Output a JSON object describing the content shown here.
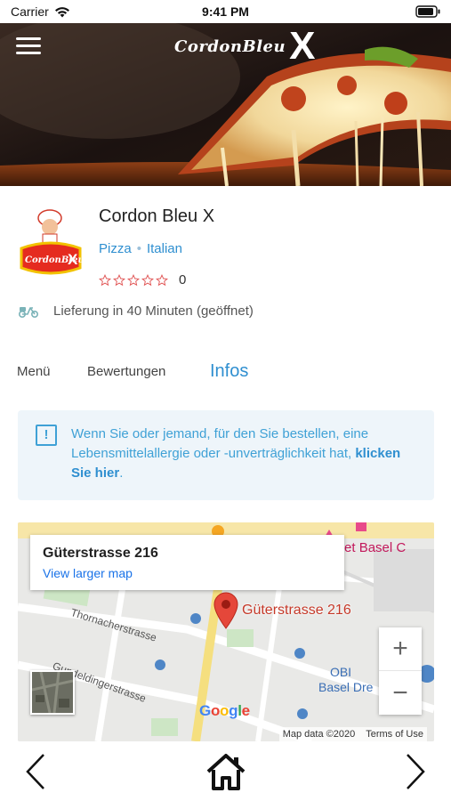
{
  "status_bar": {
    "carrier": "Carrier",
    "time": "9:41 PM"
  },
  "header": {
    "brand_text": "CordonBleu",
    "brand_x": "X"
  },
  "restaurant": {
    "name": "Cordon Bleu X",
    "categories": [
      "Pizza",
      "Italian"
    ],
    "rating_stars": 0,
    "rating_count": "0",
    "delivery_text": "Lieferung in 40 Minuten (geöffnet)",
    "logo_text": "CordonBleu"
  },
  "tabs": {
    "menu": "Menü",
    "reviews": "Bewertungen",
    "infos": "Infos",
    "active": "infos"
  },
  "allergy_notice": {
    "text": "Wenn Sie oder jemand, für den Sie bestellen, eine Lebensmittelallergie oder -unverträglichkeit hat,",
    "link": "klicken Sie hier",
    "suffix": "."
  },
  "map": {
    "card_address": "Güterstrasse 216",
    "view_larger": "View larger map",
    "pin_label": "Güterstrasse 216",
    "budget_label": "udget Basel C",
    "street_1": "Thornacherstrasse",
    "street_2": "Gundeldingerstrasse",
    "poi_obi_1": "OBI",
    "poi_obi_2": "Basel Dre",
    "google": "Google",
    "map_data": "Map data ©2020",
    "terms": "Terms of Use",
    "zoom_in": "+",
    "zoom_out": "−"
  },
  "colors": {
    "accent": "#2f8fd0",
    "star_outline": "#e05252",
    "notice_bg": "#eef5fa",
    "pin": "#e5473a"
  },
  "icons": {
    "menu": "hamburger-icon",
    "info": "info-icon",
    "delivery": "scooter-icon",
    "back": "chevron-left-icon",
    "home": "home-icon",
    "forward": "chevron-right-icon"
  }
}
